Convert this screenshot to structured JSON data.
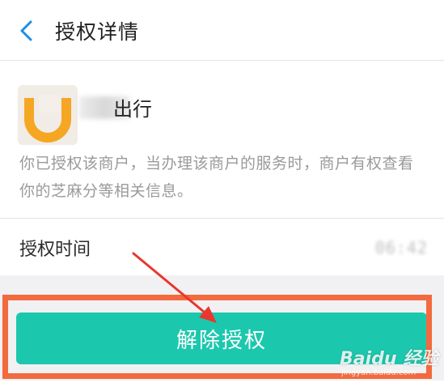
{
  "header": {
    "title": "授权详情",
    "back_icon": "chevron-left-icon"
  },
  "merchant": {
    "name_suffix": "出行",
    "logo_icon": "merchant-logo-icon",
    "description": "你已授权该商户，当办理该商户的服务时，商户有权查看你的芝麻分等相关信息。"
  },
  "auth_time": {
    "label": "授权时间",
    "value_visible_tail": "06:42"
  },
  "actions": {
    "revoke_label": "解除授权"
  },
  "watermark": {
    "brand": "Baidu 经验",
    "url": "jingyan.baidu.com"
  },
  "colors": {
    "accent_button": "#1cc8ad",
    "header_icon": "#1a8fe6",
    "highlight_frame": "#f26a3e",
    "annotation_arrow": "#e8372e",
    "logo_orange": "#f5a623"
  }
}
